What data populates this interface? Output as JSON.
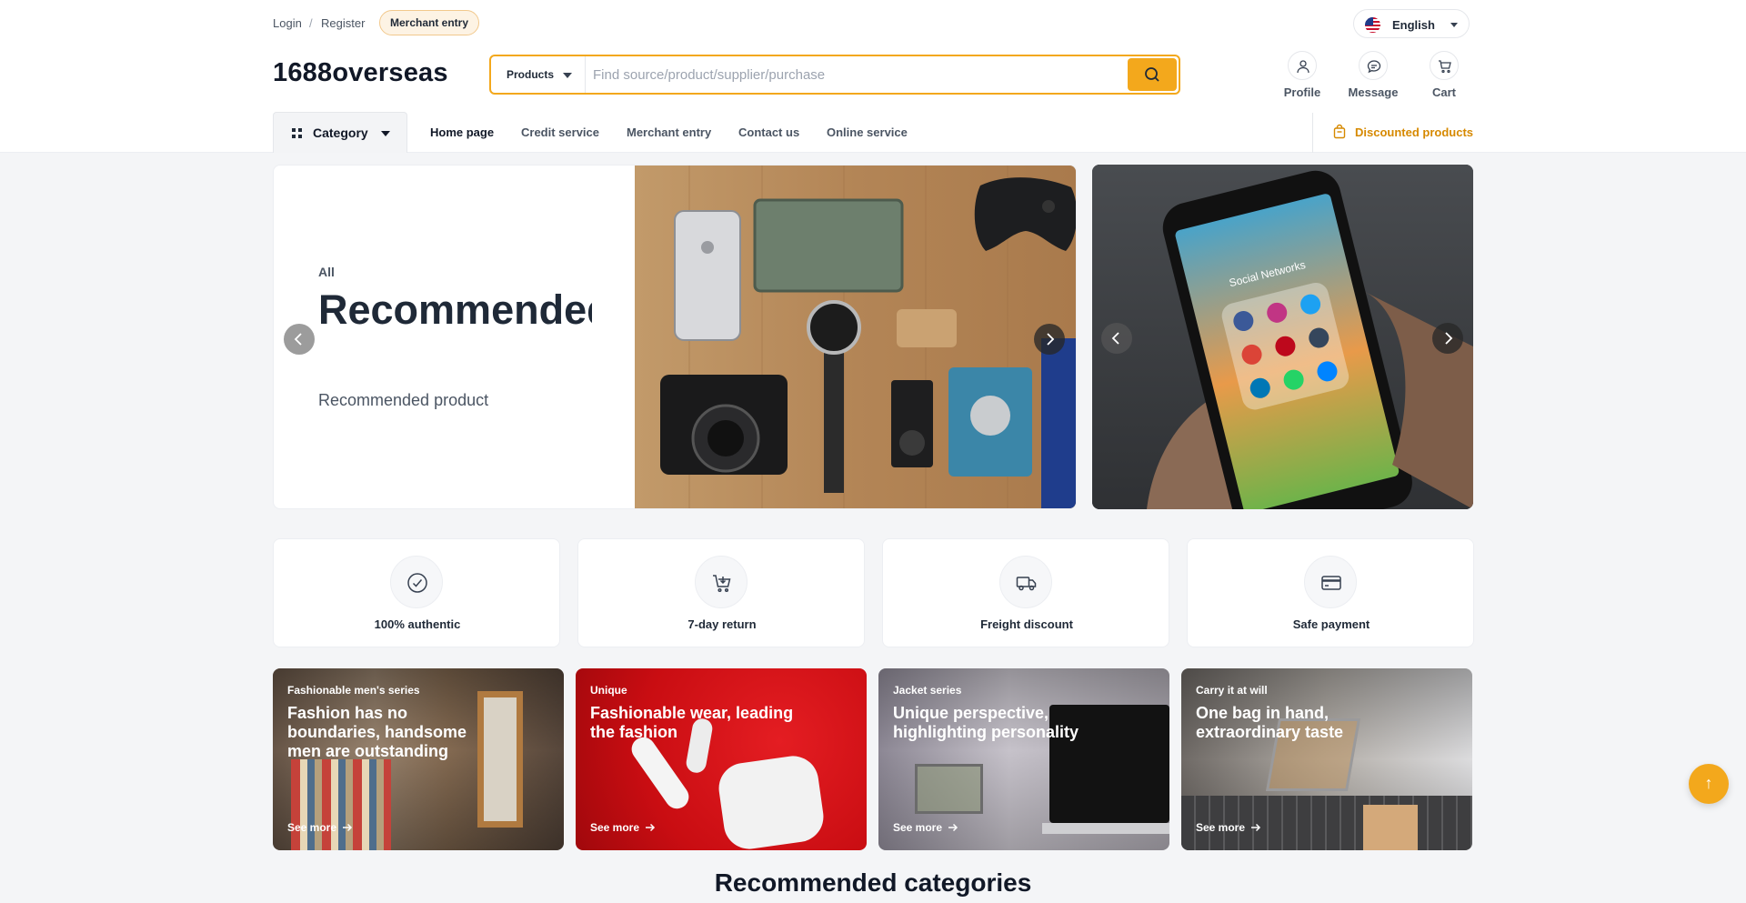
{
  "topbar": {
    "login": "Login",
    "separator": "/",
    "register": "Register",
    "merchant_entry": "Merchant entry",
    "language": "English"
  },
  "header": {
    "logo": "1688overseas",
    "search_type": "Products",
    "search_placeholder": "Find source/product/supplier/purchase",
    "icons": [
      {
        "label": "Profile",
        "icon": "user-icon"
      },
      {
        "label": "Message",
        "icon": "message-icon"
      },
      {
        "label": "Cart",
        "icon": "cart-icon"
      }
    ]
  },
  "nav": {
    "category": "Category",
    "links": [
      "Home page",
      "Credit service",
      "Merchant entry",
      "Contact us",
      "Online service"
    ],
    "active": "Home page",
    "discounted": "Discounted products"
  },
  "hero": {
    "kicker": "All",
    "title": "Recommended categories",
    "subtitle": "Recommended product"
  },
  "promo_image": {
    "screen_text": "Social Networks"
  },
  "features": [
    {
      "label": "100% authentic",
      "icon": "check-circle-icon"
    },
    {
      "label": "7-day return",
      "icon": "return-cart-icon"
    },
    {
      "label": "Freight discount",
      "icon": "truck-icon"
    },
    {
      "label": "Safe payment",
      "icon": "credit-card-icon"
    }
  ],
  "cards": [
    {
      "kicker": "Fashionable men's series",
      "title": "Fashion has no boundaries, handsome men are outstanding",
      "more": "See more"
    },
    {
      "kicker": "Unique",
      "title": "Fashionable wear, leading the fashion",
      "more": "See more"
    },
    {
      "kicker": "Jacket series",
      "title": "Unique perspective, highlighting personality",
      "more": "See more"
    },
    {
      "kicker": "Carry it at will",
      "title": "One bag in hand, extraordinary taste",
      "more": "See more"
    }
  ],
  "section_title": "Recommended categories",
  "colors": {
    "accent": "#f3a81c",
    "discount_text": "#d68900",
    "page_bg": "#f4f5f7",
    "card_red": "#d40f14"
  }
}
